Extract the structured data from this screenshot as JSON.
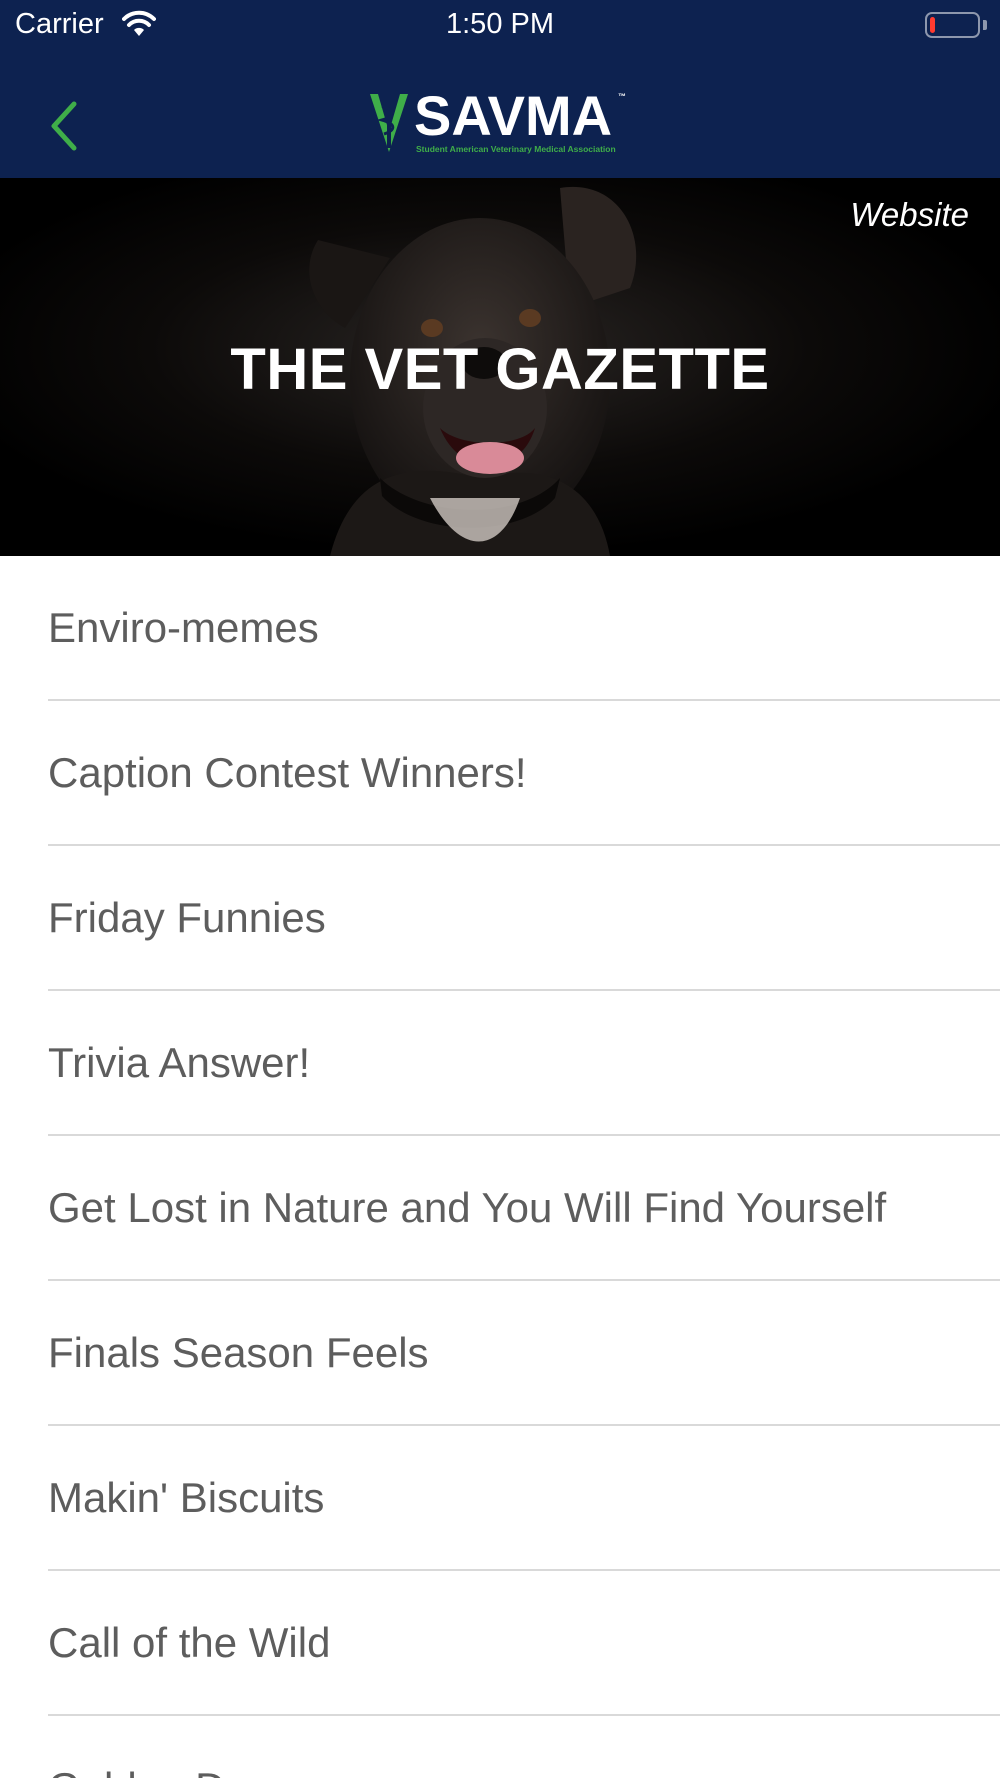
{
  "status_bar": {
    "carrier": "Carrier",
    "time": "1:50 PM",
    "battery_level": 0.12
  },
  "nav": {
    "logo_text": "SAVMA",
    "logo_tm": "™",
    "logo_subtitle": "Student American Veterinary Medical Association",
    "back_icon": "chevron-left-icon"
  },
  "hero": {
    "title": "THE VET GAZETTE",
    "link_label": "Website"
  },
  "list": {
    "items": [
      {
        "label": "Enviro-memes"
      },
      {
        "label": "Caption Contest Winners!"
      },
      {
        "label": "Friday Funnies"
      },
      {
        "label": "Trivia Answer!"
      },
      {
        "label": "Get Lost in Nature and You Will Find Yourself"
      },
      {
        "label": "Finals Season Feels"
      },
      {
        "label": "Makin' Biscuits"
      },
      {
        "label": "Call of the Wild"
      },
      {
        "label": "Golden Days"
      }
    ]
  },
  "colors": {
    "nav_bg": "#0d2250",
    "accent_green": "#3fae49",
    "text_gray": "#5d5d5d",
    "divider": "#d9d9d9"
  }
}
